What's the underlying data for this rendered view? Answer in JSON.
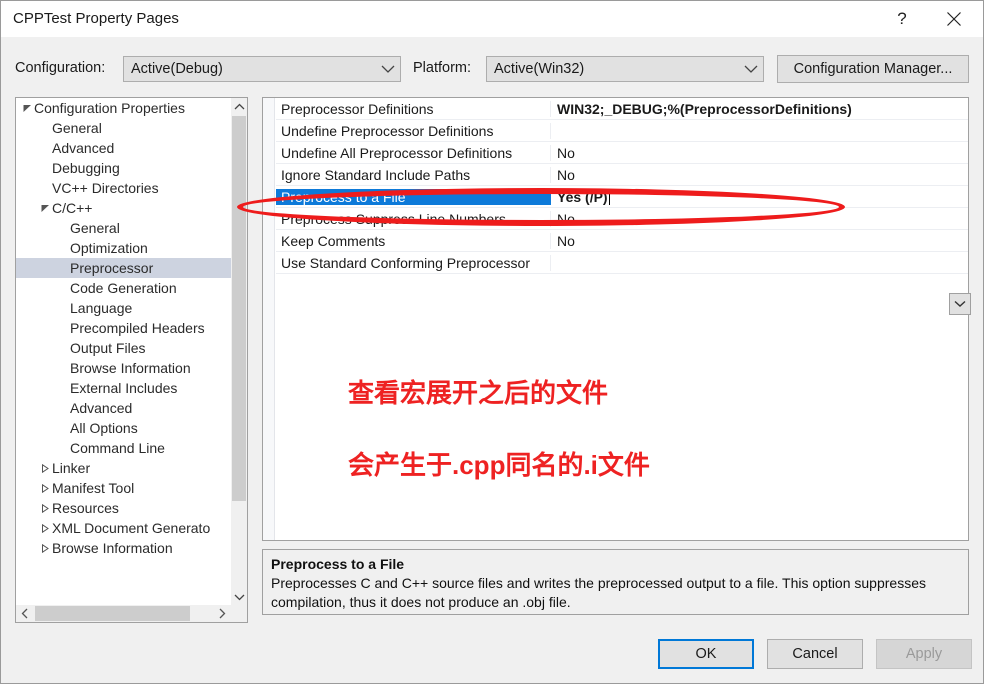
{
  "window": {
    "title": "CPPTest Property Pages",
    "help_icon": "?",
    "close_icon": "close-icon"
  },
  "toolbar": {
    "configuration_label": "Configuration:",
    "configuration_value": "Active(Debug)",
    "platform_label": "Platform:",
    "platform_value": "Active(Win32)",
    "configuration_manager_label": "Configuration Manager..."
  },
  "tree": {
    "items": [
      {
        "label": "Configuration Properties",
        "level": 0,
        "twisty": "expanded",
        "selected": false
      },
      {
        "label": "General",
        "level": 1,
        "twisty": "none",
        "selected": false
      },
      {
        "label": "Advanced",
        "level": 1,
        "twisty": "none",
        "selected": false
      },
      {
        "label": "Debugging",
        "level": 1,
        "twisty": "none",
        "selected": false
      },
      {
        "label": "VC++ Directories",
        "level": 1,
        "twisty": "none",
        "selected": false
      },
      {
        "label": "C/C++",
        "level": 1,
        "twisty": "expanded",
        "selected": false
      },
      {
        "label": "General",
        "level": 2,
        "twisty": "none",
        "selected": false
      },
      {
        "label": "Optimization",
        "level": 2,
        "twisty": "none",
        "selected": false
      },
      {
        "label": "Preprocessor",
        "level": 2,
        "twisty": "none",
        "selected": true
      },
      {
        "label": "Code Generation",
        "level": 2,
        "twisty": "none",
        "selected": false
      },
      {
        "label": "Language",
        "level": 2,
        "twisty": "none",
        "selected": false
      },
      {
        "label": "Precompiled Headers",
        "level": 2,
        "twisty": "none",
        "selected": false
      },
      {
        "label": "Output Files",
        "level": 2,
        "twisty": "none",
        "selected": false
      },
      {
        "label": "Browse Information",
        "level": 2,
        "twisty": "none",
        "selected": false
      },
      {
        "label": "External Includes",
        "level": 2,
        "twisty": "none",
        "selected": false
      },
      {
        "label": "Advanced",
        "level": 2,
        "twisty": "none",
        "selected": false
      },
      {
        "label": "All Options",
        "level": 2,
        "twisty": "none",
        "selected": false
      },
      {
        "label": "Command Line",
        "level": 2,
        "twisty": "none",
        "selected": false
      },
      {
        "label": "Linker",
        "level": 1,
        "twisty": "collapsed",
        "selected": false
      },
      {
        "label": "Manifest Tool",
        "level": 1,
        "twisty": "collapsed",
        "selected": false
      },
      {
        "label": "Resources",
        "level": 1,
        "twisty": "collapsed",
        "selected": false
      },
      {
        "label": "XML Document Generato",
        "level": 1,
        "twisty": "collapsed",
        "selected": false
      },
      {
        "label": "Browse Information",
        "level": 1,
        "twisty": "collapsed",
        "selected": false
      }
    ]
  },
  "grid": {
    "rows": [
      {
        "name": "Preprocessor Definitions",
        "value": "WIN32;_DEBUG;%(PreprocessorDefinitions)",
        "bold": true,
        "selected": false
      },
      {
        "name": "Undefine Preprocessor Definitions",
        "value": "",
        "bold": false,
        "selected": false
      },
      {
        "name": "Undefine All Preprocessor Definitions",
        "value": "No",
        "bold": false,
        "selected": false
      },
      {
        "name": "Ignore Standard Include Paths",
        "value": "No",
        "bold": false,
        "selected": false
      },
      {
        "name": "Preprocess to a File",
        "value": "Yes (/P)",
        "bold": true,
        "selected": true
      },
      {
        "name": "Preprocess Suppress Line Numbers",
        "value": "No",
        "bold": false,
        "selected": false
      },
      {
        "name": "Keep Comments",
        "value": "No",
        "bold": false,
        "selected": false
      },
      {
        "name": "Use Standard Conforming Preprocessor",
        "value": "",
        "bold": false,
        "selected": false
      }
    ],
    "dropdown_icon": "chevron-down-icon"
  },
  "annotations": {
    "note_1": "查看宏展开之后的文件",
    "note_2": "会产生于.cpp同名的.i文件",
    "highlight_color": "#ee1c1c",
    "note_color": "#ee2222"
  },
  "description": {
    "title": "Preprocess to a File",
    "body": "Preprocesses C and C++ source files and writes the preprocessed output to a file. This option suppresses compilation, thus it does not produce an .obj file."
  },
  "footer": {
    "ok_label": "OK",
    "cancel_label": "Cancel",
    "apply_label": "Apply"
  },
  "colors": {
    "selection_blue": "#0d7ad9",
    "tree_selection": "#cdd3e0",
    "focus_border": "#0078d7"
  }
}
